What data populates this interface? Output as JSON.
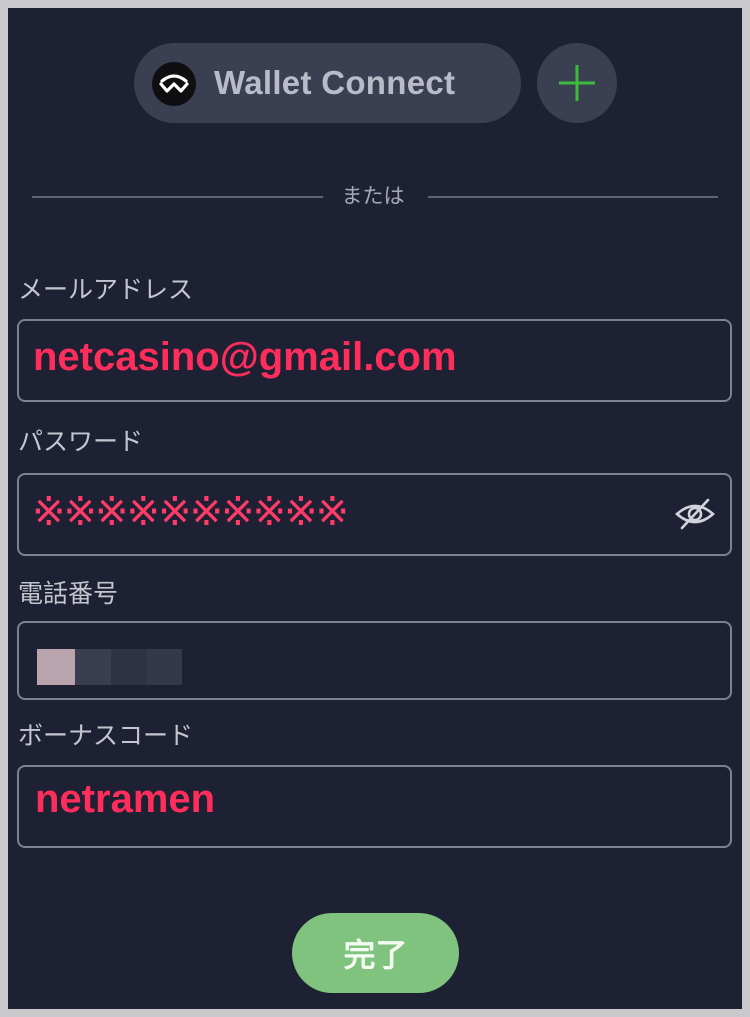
{
  "wallet_connect": {
    "label": "Wallet Connect",
    "icon": "walletconnect-logo-icon"
  },
  "add_button": {
    "icon": "plus-icon",
    "color": "#3dbb3d"
  },
  "divider": {
    "text": "または"
  },
  "email": {
    "label": "メールアドレス",
    "value": "netcasino@gmail.com"
  },
  "password": {
    "label": "パスワード",
    "value": "※※※※※※※※※※",
    "icon": "eye-off-icon"
  },
  "phone": {
    "label": "電話番号",
    "value": ""
  },
  "bonus_code": {
    "label": "ボーナスコード",
    "value": "netramen"
  },
  "submit": {
    "label": "完了"
  },
  "colors": {
    "background": "#1d2133",
    "pill": "#3b3f52",
    "annotation_red": "#ff2d5c",
    "button_green": "#7fc37e"
  }
}
